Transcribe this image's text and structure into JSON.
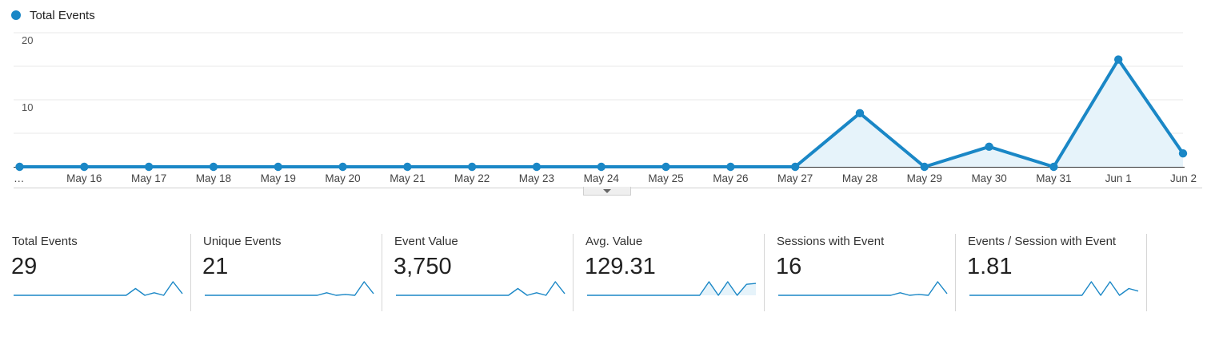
{
  "legend": {
    "label": "Total Events",
    "color": "#1a87c6"
  },
  "chart_data": {
    "type": "area",
    "series": [
      {
        "name": "Total Events",
        "values": [
          0,
          0,
          0,
          0,
          0,
          0,
          0,
          0,
          0,
          0,
          0,
          0,
          0,
          8,
          0,
          3,
          0,
          16,
          2
        ]
      }
    ],
    "categories": [
      "…",
      "May 16",
      "May 17",
      "May 18",
      "May 19",
      "May 20",
      "May 21",
      "May 22",
      "May 23",
      "May 24",
      "May 25",
      "May 26",
      "May 27",
      "May 28",
      "May 29",
      "May 30",
      "May 31",
      "Jun 1",
      "Jun 2"
    ],
    "yticks": [
      "20",
      "10"
    ],
    "ylim": [
      0,
      20
    ],
    "grid": true,
    "legend_position": "top-left",
    "line_color": "#1a87c6",
    "fill_color": "#e6f3fa"
  },
  "metrics": [
    {
      "label": "Total Events",
      "value": "29",
      "spark": [
        0,
        0,
        0,
        0,
        0,
        0,
        0,
        0,
        0,
        0,
        0,
        0,
        0,
        8,
        0,
        3,
        0,
        16,
        2
      ]
    },
    {
      "label": "Unique Events",
      "value": "21",
      "spark": [
        0,
        0,
        0,
        0,
        0,
        0,
        0,
        0,
        0,
        0,
        0,
        0,
        0,
        3,
        0,
        1,
        0,
        16,
        2
      ]
    },
    {
      "label": "Event Value",
      "value": "3,750",
      "spark": [
        0,
        0,
        0,
        0,
        0,
        0,
        0,
        0,
        0,
        0,
        0,
        0,
        0,
        8,
        0,
        3,
        0,
        16,
        2
      ]
    },
    {
      "label": "Avg. Value",
      "value": "129.31",
      "spark": [
        0,
        0,
        0,
        0,
        0,
        0,
        0,
        0,
        0,
        0,
        0,
        0,
        0,
        16,
        0,
        16,
        0,
        13,
        14
      ],
      "filled": true
    },
    {
      "label": "Sessions with Event",
      "value": "16",
      "spark": [
        0,
        0,
        0,
        0,
        0,
        0,
        0,
        0,
        0,
        0,
        0,
        0,
        0,
        3,
        0,
        1,
        0,
        16,
        2
      ]
    },
    {
      "label": "Events / Session with Event",
      "value": "1.81",
      "spark": [
        0,
        0,
        0,
        0,
        0,
        0,
        0,
        0,
        0,
        0,
        0,
        0,
        0,
        16,
        0,
        16,
        0,
        8,
        5
      ]
    }
  ]
}
